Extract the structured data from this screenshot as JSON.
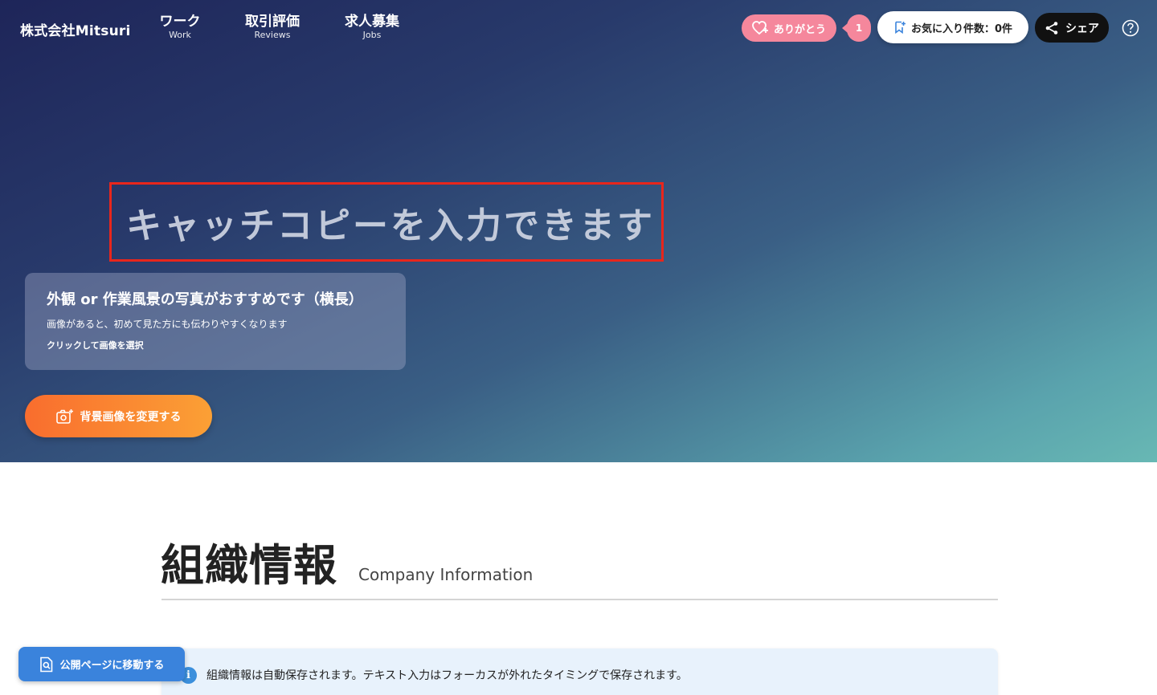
{
  "header": {
    "brand": "株式会社Mitsuri",
    "nav": [
      {
        "jp": "ワーク",
        "en": "Work"
      },
      {
        "jp": "取引評価",
        "en": "Reviews"
      },
      {
        "jp": "求人募集",
        "en": "Jobs"
      }
    ],
    "thanks_label": "ありがとう",
    "thanks_count": "1",
    "favorites_label": "お気に入り件数：0件",
    "share_label": "シェア",
    "help_icon": "help-icon"
  },
  "hero": {
    "catchcopy": "キャッチコピーを入力できます",
    "photo_card": {
      "title": "外観 or 作業風景の写真がおすすめです（横長）",
      "description": "画像があると、初めて見た方にも伝わりやすくなります",
      "action": "クリックして画像を選択"
    },
    "change_bg_label": "背景画像を変更する"
  },
  "section": {
    "title_jp": "組織情報",
    "title_en": "Company Information"
  },
  "info_banner": {
    "icon_label": "i",
    "text": "組織情報は自動保存されます。テキスト入力はフォーカスが外れたタイミングで保存されます。"
  },
  "public_page_label": "公開ページに移動する",
  "colors": {
    "accent_pink": "#f5879c",
    "accent_orange": "#f96d2e",
    "accent_blue": "#3a83dc",
    "highlight_red": "#e8261c"
  }
}
